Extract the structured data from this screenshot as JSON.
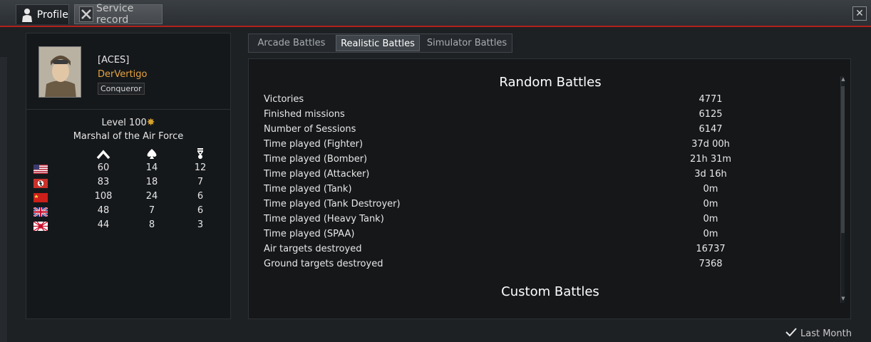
{
  "tabs": [
    {
      "label": "Profile",
      "icon": "pilot-silhouette-icon"
    },
    {
      "label": "Service record",
      "icon": "crossed-tools-icon"
    }
  ],
  "close_icon": "close-icon",
  "profile": {
    "clan": "[ACES]",
    "nickname": "DerVertigo",
    "title": "Conqueror",
    "level": "Level 100",
    "rank": "Marshal of the Air Force",
    "accent_color": "#e7a33e"
  },
  "nation_stats": {
    "columns": [
      "chevron-icon",
      "spade-icon",
      "medal-icon"
    ],
    "rows": [
      {
        "nation": "usa-flag-icon",
        "values": [
          "60",
          "14",
          "12"
        ]
      },
      {
        "nation": "germany-flag-icon",
        "values": [
          "83",
          "18",
          "7"
        ]
      },
      {
        "nation": "ussr-flag-icon",
        "values": [
          "108",
          "24",
          "6"
        ]
      },
      {
        "nation": "britain-flag-icon",
        "values": [
          "48",
          "7",
          "6"
        ]
      },
      {
        "nation": "japan-flag-icon",
        "values": [
          "44",
          "8",
          "3"
        ]
      }
    ]
  },
  "mode_tabs": [
    "Arcade Battles",
    "Realistic Battles",
    "Simulator Battles"
  ],
  "selected_mode": "Realistic Battles",
  "random_battles": {
    "title": "Random Battles",
    "rows": [
      {
        "label": "Victories",
        "value": "4771"
      },
      {
        "label": "Finished missions",
        "value": "6125"
      },
      {
        "label": "Number of Sessions",
        "value": "6147"
      },
      {
        "label": "Time played (Fighter)",
        "value": "37d 00h"
      },
      {
        "label": "Time played (Bomber)",
        "value": "21h 31m"
      },
      {
        "label": "Time played (Attacker)",
        "value": "3d 16h"
      },
      {
        "label": "Time played (Tank)",
        "value": "0m"
      },
      {
        "label": "Time played (Tank Destroyer)",
        "value": "0m"
      },
      {
        "label": "Time played (Heavy Tank)",
        "value": "0m"
      },
      {
        "label": "Time played (SPAA)",
        "value": "0m"
      },
      {
        "label": "Air targets destroyed",
        "value": "16737"
      },
      {
        "label": "Ground targets destroyed",
        "value": "7368"
      }
    ]
  },
  "custom_battles": {
    "title": "Custom Battles"
  },
  "footer": {
    "last_month_label": "Last Month",
    "last_month_checked": true
  }
}
